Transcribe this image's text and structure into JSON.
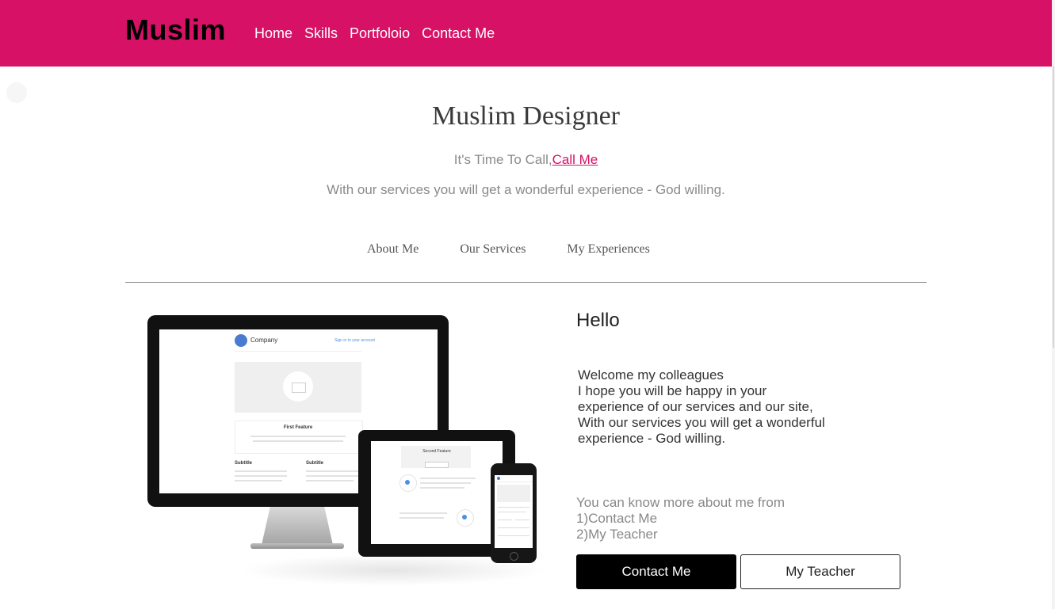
{
  "header": {
    "brand": "Muslim",
    "nav": [
      "Home",
      "Skills",
      "Portfoloio",
      "Contact Me"
    ],
    "background_color": "#d61166"
  },
  "hero": {
    "title": "Muslim Designer",
    "call_prefix": "It's Time To Call,",
    "call_link": "Call Me",
    "subtitle": "With our services you will get a wonderful experience - God willing."
  },
  "tabs": [
    "About Me",
    "Our Services",
    "My Experiences"
  ],
  "illustration": {
    "company": "Company",
    "sign_in": "Sign in to your account",
    "first_feature": "First Feature",
    "subtitle_1": "Subtitle",
    "subtitle_2": "Subtitle",
    "tablet_title": "Second Feature"
  },
  "about": {
    "heading": "Hello",
    "welcome_lines": [
      "Welcome my colleagues",
      "I hope you will be happy in your",
      "experience of our services and our site,",
      "With our services you will get a wonderful",
      "experience - God willing."
    ],
    "more_lines": [
      "You can know more about me from",
      "1)Contact Me",
      "2)My Teacher"
    ],
    "primary_button": "Contact Me",
    "secondary_button": "My Teacher"
  },
  "colors": {
    "accent": "#d61166",
    "primary_button_bg": "#000000"
  }
}
